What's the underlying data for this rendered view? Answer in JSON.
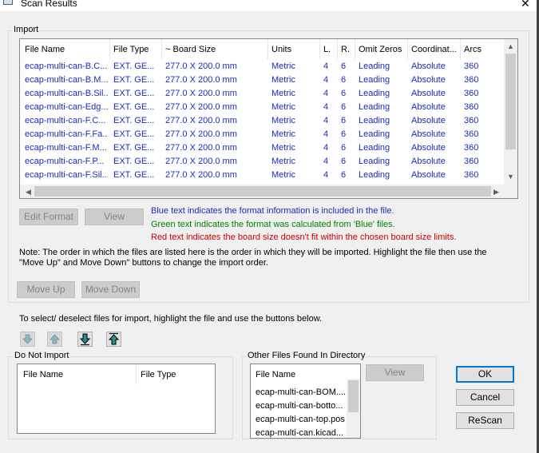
{
  "window": {
    "title": "Scan Results",
    "close_glyph": "✕"
  },
  "import": {
    "group_label": "Import",
    "columns": [
      "File Name",
      "File Type",
      "~ Board Size",
      "Units",
      "L.",
      "R.",
      "Omit Zeros",
      "Coordinat...",
      "Arcs"
    ],
    "rows": [
      {
        "file": "ecap-multi-can-B.C...",
        "type": "EXT. GE...",
        "size": "277.0 X 200.0 mm",
        "units": "Metric",
        "l": "4",
        "r": "6",
        "omit": "Leading",
        "coord": "Absolute",
        "arcs": "360"
      },
      {
        "file": "ecap-multi-can-B.M...",
        "type": "EXT. GE...",
        "size": "277.0 X 200.0 mm",
        "units": "Metric",
        "l": "4",
        "r": "6",
        "omit": "Leading",
        "coord": "Absolute",
        "arcs": "360"
      },
      {
        "file": "ecap-multi-can-B.Sil...",
        "type": "EXT. GE...",
        "size": "277.0 X 200.0 mm",
        "units": "Metric",
        "l": "4",
        "r": "6",
        "omit": "Leading",
        "coord": "Absolute",
        "arcs": "360"
      },
      {
        "file": "ecap-multi-can-Edg...",
        "type": "EXT. GE...",
        "size": "277.0 X 200.0 mm",
        "units": "Metric",
        "l": "4",
        "r": "6",
        "omit": "Leading",
        "coord": "Absolute",
        "arcs": "360"
      },
      {
        "file": "ecap-multi-can-F.C...",
        "type": "EXT. GE...",
        "size": "277.0 X 200.0 mm",
        "units": "Metric",
        "l": "4",
        "r": "6",
        "omit": "Leading",
        "coord": "Absolute",
        "arcs": "360"
      },
      {
        "file": "ecap-multi-can-F.Fa...",
        "type": "EXT. GE...",
        "size": "277.0 X 200.0 mm",
        "units": "Metric",
        "l": "4",
        "r": "6",
        "omit": "Leading",
        "coord": "Absolute",
        "arcs": "360"
      },
      {
        "file": "ecap-multi-can-F.M...",
        "type": "EXT. GE...",
        "size": "277.0 X 200.0 mm",
        "units": "Metric",
        "l": "4",
        "r": "6",
        "omit": "Leading",
        "coord": "Absolute",
        "arcs": "360"
      },
      {
        "file": "ecap-multi-can-F.P...",
        "type": "EXT. GE...",
        "size": "277.0 X 200.0 mm",
        "units": "Metric",
        "l": "4",
        "r": "6",
        "omit": "Leading",
        "coord": "Absolute",
        "arcs": "360"
      },
      {
        "file": "ecap-multi-can-F.Sil...",
        "type": "EXT. GE...",
        "size": "277.0 X 200.0 mm",
        "units": "Metric",
        "l": "4",
        "r": "6",
        "omit": "Leading",
        "coord": "Absolute",
        "arcs": "360"
      }
    ],
    "edit_format_label": "Edit Format",
    "view_label": "View",
    "legend_blue": "Blue text indicates the format information is included in the file.",
    "legend_green": "Green text indicates the format was calculated from 'Blue' files.",
    "legend_red": "Red text indicates the board size doesn't fit within the chosen board size limits.",
    "note_line1": "Note: The order in which the files are listed here is the order in which they will be imported.  Highlight the file then use the",
    "note_line2": "\"Move Up\" and Move Down\" buttons to change the import order.",
    "move_up_label": "Move Up",
    "move_down_label": "Move Down"
  },
  "select_instructions": "To select/ deselect files for import, highlight the file and use the buttons below.",
  "do_not_import": {
    "group_label": "Do Not Import",
    "columns": [
      "File Name",
      "File Type"
    ]
  },
  "other_files": {
    "group_label": "Other Files Found In Directory",
    "column": "File Name",
    "items": [
      "ecap-multi-can-BOM....",
      "ecap-multi-can-botto...",
      "ecap-multi-can-top.pos",
      "ecap-multi-can.kicad..."
    ],
    "view_label": "View"
  },
  "buttons": {
    "ok": "OK",
    "cancel": "Cancel",
    "rescan": "ReScan"
  },
  "colors": {
    "blue_text": "#1a2bbf",
    "green_text": "#008000",
    "red_text": "#cc0000",
    "focus_blue": "#0078d7",
    "teal_arrow": "#2a8c8c"
  },
  "icons": [
    "app-icon",
    "close-icon",
    "move-down-arrow-icon",
    "move-up-arrow-icon",
    "move-down-bold-arrow-icon",
    "move-up-bold-arrow-icon",
    "scroll-up-icon",
    "scroll-down-icon",
    "scroll-left-icon",
    "scroll-right-icon"
  ]
}
